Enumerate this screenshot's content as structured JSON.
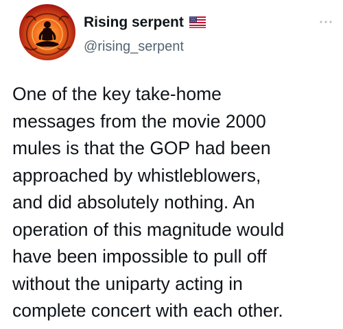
{
  "user": {
    "display_name": "Rising serpent",
    "handle": "@rising_serpent",
    "badge_icon": "us-flag-icon",
    "avatar_colors": [
      "#ffb347",
      "#f26a1b",
      "#a81b12",
      "#3a0a06"
    ]
  },
  "tweet": {
    "text": "One of the key take-home\nmessages from the movie 2000\nmules is that the GOP had been\napproached by whistleblowers,\nand did absolutely nothing. An\noperation of this magnitude would\nhave been impossible to pull off\nwithout the uniparty acting in\ncomplete concert with each other."
  },
  "menu": {
    "icon": "more-options-icon"
  }
}
